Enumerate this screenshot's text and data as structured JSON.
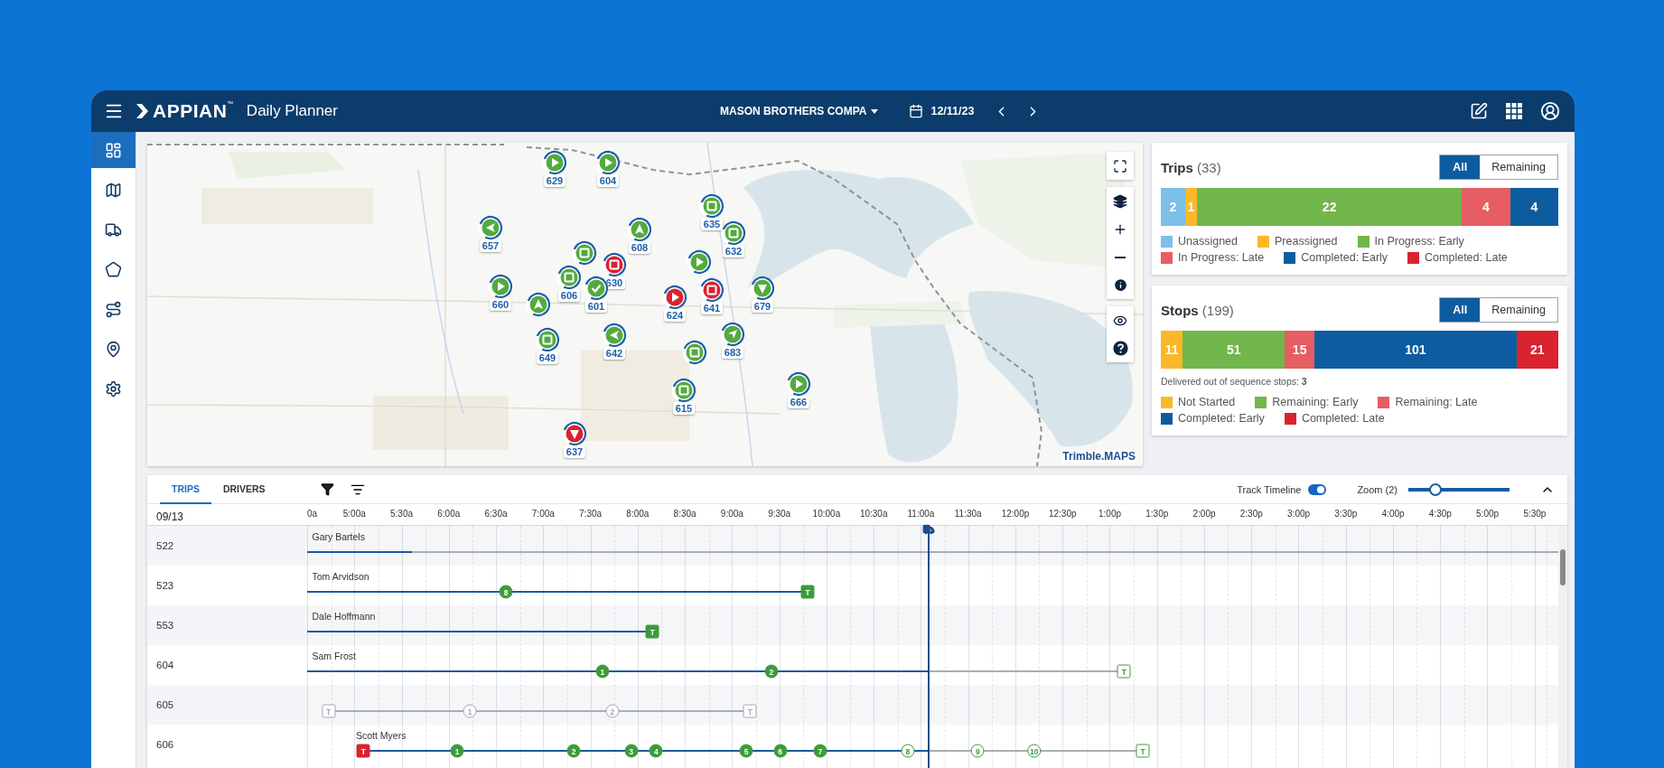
{
  "header": {
    "app_name": "APPIAN",
    "trademark": "™",
    "title": "Daily Planner",
    "company": "MASON BROTHERS COMPA",
    "date": "12/11/23"
  },
  "sidebar": {
    "items": [
      {
        "kind": "dashboard",
        "selected": true
      },
      {
        "kind": "map",
        "selected": false
      },
      {
        "kind": "trucks",
        "selected": false
      },
      {
        "kind": "area",
        "selected": false
      },
      {
        "kind": "route",
        "selected": false
      },
      {
        "kind": "location",
        "selected": false
      },
      {
        "kind": "settings",
        "selected": false
      }
    ]
  },
  "map": {
    "attribution": "Trimble.MAPS",
    "markers": [
      {
        "label": "629",
        "kind": "play",
        "color": "#52ab3f"
      },
      {
        "label": "604",
        "kind": "play",
        "color": "#52ab3f"
      },
      {
        "label": "657",
        "kind": "left",
        "color": "#52ab3f"
      },
      {
        "label": "635",
        "kind": "stop",
        "color": "#52ab3f"
      },
      {
        "label": "608",
        "kind": "up",
        "color": "#52ab3f"
      },
      {
        "label": "632",
        "kind": "stop",
        "color": "#52ab3f"
      },
      {
        "label": "660",
        "kind": "play",
        "color": "#52ab3f"
      },
      {
        "kind": "stop",
        "color": "#52ab3f"
      },
      {
        "label": "630",
        "kind": "stop",
        "color": "#d9232f"
      },
      {
        "label": "606",
        "kind": "stop",
        "color": "#52ab3f"
      },
      {
        "label": "601",
        "kind": "check",
        "color": "#52ab3f"
      },
      {
        "kind": "up",
        "color": "#52ab3f"
      },
      {
        "label": "649",
        "kind": "stop",
        "color": "#52ab3f"
      },
      {
        "label": "642",
        "kind": "left",
        "color": "#52ab3f"
      },
      {
        "label": "624",
        "kind": "play",
        "color": "#d9232f"
      },
      {
        "kind": "play",
        "color": "#52ab3f"
      },
      {
        "label": "641",
        "kind": "stop",
        "color": "#d9232f"
      },
      {
        "label": "679",
        "kind": "down",
        "color": "#52ab3f"
      },
      {
        "label": "683",
        "kind": "navigate",
        "color": "#52ab3f"
      },
      {
        "kind": "stop",
        "color": "#52ab3f"
      },
      {
        "label": "615",
        "kind": "stop",
        "color": "#52ab3f"
      },
      {
        "label": "666",
        "kind": "play",
        "color": "#52ab3f"
      },
      {
        "label": "637",
        "kind": "down",
        "color": "#d9232f"
      }
    ]
  },
  "trips": {
    "title": "Trips",
    "count": "(33)",
    "filters": [
      {
        "label": "All",
        "selected": true
      },
      {
        "label": "Remaining",
        "selected": false
      }
    ],
    "segments": [
      {
        "value": "2",
        "color": "#7cbfe8"
      },
      {
        "value": "1",
        "color": "#fbb829"
      },
      {
        "value": "22",
        "color": "#72b64c"
      },
      {
        "value": "4",
        "color": "#e65d63"
      },
      {
        "value": "4",
        "color": "#0e5ca0"
      }
    ],
    "legend": [
      {
        "label": "Unassigned",
        "color": "#7cbfe8"
      },
      {
        "label": "Preassigned",
        "color": "#fbb829"
      },
      {
        "label": "In Progress: Early",
        "color": "#72b64c"
      },
      {
        "label": "In Progress: Late",
        "color": "#e65d63"
      },
      {
        "label": "Completed: Early",
        "color": "#0e5ca0"
      },
      {
        "label": "Completed: Late",
        "color": "#d9232f"
      }
    ]
  },
  "stops": {
    "title": "Stops",
    "count": "(199)",
    "filters": [
      {
        "label": "All",
        "selected": true
      },
      {
        "label": "Remaining",
        "selected": false
      }
    ],
    "segments": [
      {
        "value": "11",
        "color": "#fbb829"
      },
      {
        "value": "51",
        "color": "#72b64c"
      },
      {
        "value": "15",
        "color": "#e65d63"
      },
      {
        "value": "101",
        "color": "#0e5ca0"
      },
      {
        "value": "21",
        "color": "#d9232f"
      }
    ],
    "note": "Delivered out of sequence stops: **3**",
    "legend": [
      {
        "label": "Not Started",
        "color": "#fbb829"
      },
      {
        "label": "Remaining: Early",
        "color": "#72b64c"
      },
      {
        "label": "Remaining: Late",
        "color": "#e65d63"
      },
      {
        "label": "Completed: Early",
        "color": "#0e5ca0"
      },
      {
        "label": "Completed: Late",
        "color": "#d9232f"
      }
    ]
  },
  "timeline": {
    "tabs": [
      {
        "label": "TRIPS",
        "selected": true
      },
      {
        "label": "DRIVERS",
        "selected": false
      }
    ],
    "track_timeline": {
      "label": "Track Timeline",
      "on": true
    },
    "zoom": {
      "label": "Zoom (2)",
      "level": 0.27
    },
    "date": "09/13",
    "times": [
      "0a",
      "5:00a",
      "5:30a",
      "6:00a",
      "6:30a",
      "7:00a",
      "7:30a",
      "8:00a",
      "8:30a",
      "9:00a",
      "9:30a",
      "10:00a",
      "10:30a",
      "11:00a",
      "11:30a",
      "12:00p",
      "12:30p",
      "1:00p",
      "1:30p",
      "2:00p",
      "2:30p",
      "3:00p",
      "3:30p",
      "4:00p",
      "4:30p",
      "5:00p",
      "5:30p"
    ],
    "rows": [
      {
        "trip": "522",
        "driver": "Gary Bartels",
        "markers": []
      },
      {
        "trip": "523",
        "driver": "Tom Arvidson",
        "markers": [
          {
            "kind": "stop",
            "label": "8",
            "filled": true,
            "color": "#3e9b3a"
          },
          {
            "kind": "terminal",
            "label": "T",
            "filled": true,
            "color": "#3e9b3a"
          }
        ]
      },
      {
        "trip": "553",
        "driver": "Dale Hoffmann",
        "markers": [
          {
            "kind": "terminal",
            "label": "T",
            "filled": true,
            "color": "#3e9b3a"
          }
        ]
      },
      {
        "trip": "604",
        "driver": "Sam Frost",
        "markers": [
          {
            "kind": "stop",
            "label": "1",
            "filled": true,
            "color": "#3e9b3a"
          },
          {
            "kind": "stop",
            "label": "2",
            "filled": true,
            "color": "#3e9b3a"
          },
          {
            "kind": "terminal",
            "label": "T",
            "filled": false,
            "color": "#3e9b3a"
          }
        ]
      },
      {
        "trip": "605",
        "markers": [
          {
            "kind": "terminal",
            "label": "T",
            "filled": false,
            "color": "#a3a8b0"
          },
          {
            "kind": "stop",
            "label": "1",
            "filled": false,
            "color": "#a3a8b0"
          },
          {
            "kind": "stop",
            "label": "2",
            "filled": false,
            "color": "#a3a8b0"
          },
          {
            "kind": "terminal",
            "label": "T",
            "filled": false,
            "color": "#a3a8b0"
          }
        ]
      },
      {
        "trip": "606",
        "driver": "Scott Myers",
        "markers": [
          {
            "kind": "terminal",
            "label": "T",
            "filled": true,
            "color": "#d9232f"
          },
          {
            "kind": "stop",
            "label": "1",
            "filled": true,
            "color": "#3e9b3a"
          },
          {
            "kind": "stop",
            "label": "2",
            "filled": true,
            "color": "#3e9b3a"
          },
          {
            "kind": "stop",
            "label": "3",
            "filled": true,
            "color": "#3e9b3a"
          },
          {
            "kind": "stop",
            "label": "4",
            "filled": true,
            "color": "#3e9b3a"
          },
          {
            "kind": "stop",
            "label": "5",
            "filled": true,
            "color": "#3e9b3a"
          },
          {
            "kind": "stop",
            "label": "6",
            "filled": true,
            "color": "#3e9b3a"
          },
          {
            "kind": "stop",
            "label": "7",
            "filled": true,
            "color": "#3e9b3a"
          },
          {
            "kind": "stop",
            "label": "8",
            "filled": false,
            "color": "#3e9b3a"
          },
          {
            "kind": "stop",
            "label": "9",
            "filled": false,
            "color": "#3e9b3a"
          },
          {
            "kind": "stop",
            "label": "10",
            "filled": false,
            "color": "#3e9b3a"
          },
          {
            "kind": "terminal",
            "label": "T",
            "filled": false,
            "color": "#3e9b3a"
          }
        ]
      }
    ]
  }
}
